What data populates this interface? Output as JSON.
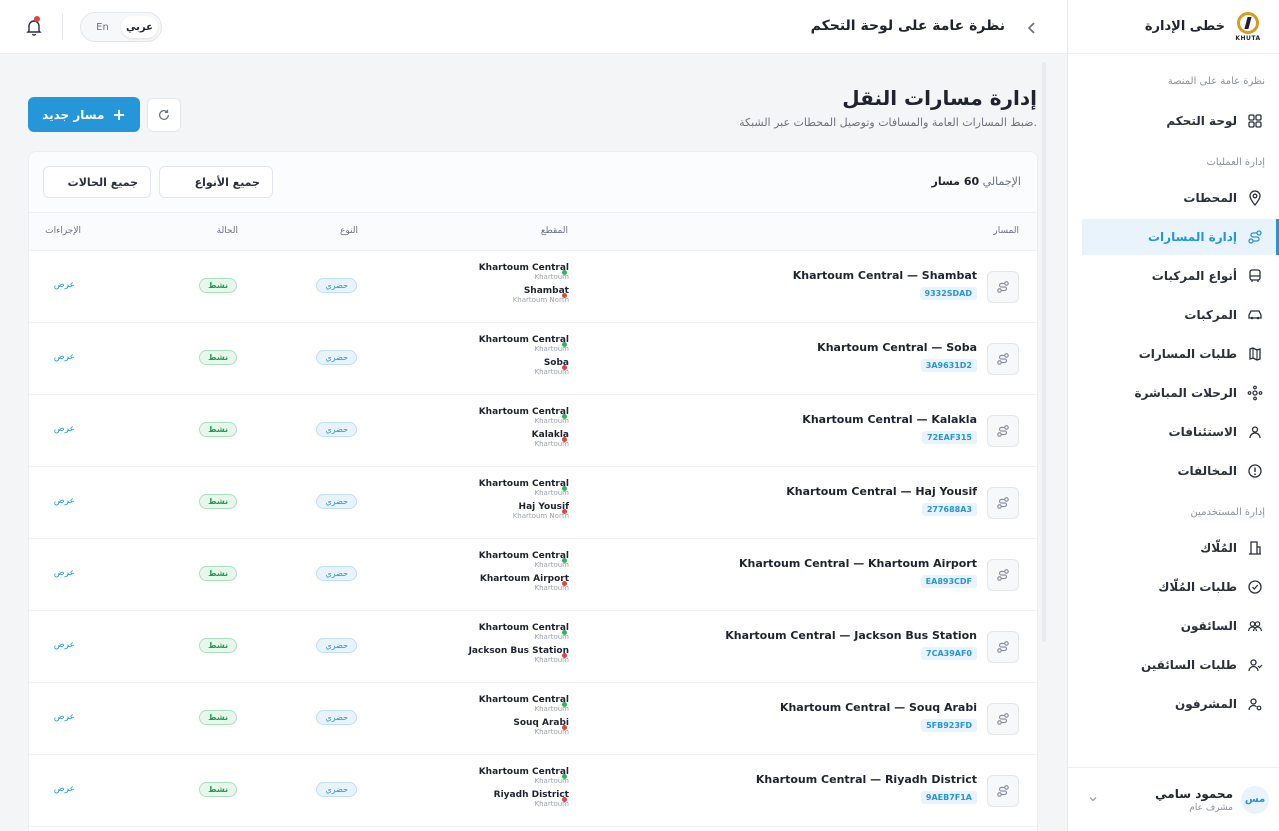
{
  "sidebar": {
    "brand": "خطى الإدارة",
    "logo_text": "KHUTA",
    "sections": {
      "platform": "نظرة عامة على المنصة",
      "operations": "إدارة العمليات",
      "users": "إدارة المستخدمين"
    },
    "items": {
      "dashboard": "لوحة التحكم",
      "stations": "المحطات",
      "routes": "إدارة المسارات",
      "vehicle_types": "أنواع المركبات",
      "vehicles": "المركبات",
      "route_requests": "طلبات المسارات",
      "live_trips": "الرحلات المباشرة",
      "appeals": "الاستئنافات",
      "violations": "المخالفات",
      "owners": "المُلّاك",
      "owner_requests": "طلبات المُلّاك",
      "drivers": "السائقون",
      "driver_requests": "طلبات السائقين",
      "supervisors": "المشرفون"
    },
    "user": {
      "name": "محمود سامي",
      "role": "مشرف عام",
      "initials": "مس"
    }
  },
  "topbar": {
    "title": "نظرة عامة على لوحة التحكم",
    "lang_ar": "عربي",
    "lang_en": "En"
  },
  "page": {
    "title": "إدارة مسارات النقل",
    "subtitle": "ضبط المسارات العامة والمسافات وتوصيل المحطات عبر الشبكة.",
    "new_button": "مسار جديد",
    "total_label": "الإجمالي",
    "total_value": "60 مسار",
    "filter_types": "جميع الأنواع",
    "filter_status": "جميع الحالات"
  },
  "table": {
    "headers": {
      "route": "المسار",
      "segment": "المقطع",
      "type": "النوع",
      "status": "الحالة",
      "actions": "الإجراءات"
    },
    "rows": [
      {
        "name": "Khartoum Central — Shambat",
        "code": "9332SDAD",
        "from": "Khartoum Central",
        "from_area": "Khartoum",
        "to": "Shambat",
        "to_area": "Khartoum North",
        "type": "حضري",
        "status": "نشط",
        "action": "عرض"
      },
      {
        "name": "Khartoum Central — Soba",
        "code": "3A9631D2",
        "from": "Khartoum Central",
        "from_area": "Khartoum",
        "to": "Soba",
        "to_area": "Khartoum",
        "type": "حضري",
        "status": "نشط",
        "action": "عرض"
      },
      {
        "name": "Khartoum Central — Kalakla",
        "code": "72EAF315",
        "from": "Khartoum Central",
        "from_area": "Khartoum",
        "to": "Kalakla",
        "to_area": "Khartoum",
        "type": "حضري",
        "status": "نشط",
        "action": "عرض"
      },
      {
        "name": "Khartoum Central — Haj Yousif",
        "code": "277688A3",
        "from": "Khartoum Central",
        "from_area": "Khartoum",
        "to": "Haj Yousif",
        "to_area": "Khartoum North",
        "type": "حضري",
        "status": "نشط",
        "action": "عرض"
      },
      {
        "name": "Khartoum Central — Khartoum Airport",
        "code": "EA893CDF",
        "from": "Khartoum Central",
        "from_area": "Khartoum",
        "to": "Khartoum Airport",
        "to_area": "Khartoum",
        "type": "حضري",
        "status": "نشط",
        "action": "عرض"
      },
      {
        "name": "Khartoum Central — Jackson Bus Station",
        "code": "7CA39AF0",
        "from": "Khartoum Central",
        "from_area": "Khartoum",
        "to": "Jackson Bus Station",
        "to_area": "Khartoum",
        "type": "حضري",
        "status": "نشط",
        "action": "عرض"
      },
      {
        "name": "Khartoum Central — Souq Arabi",
        "code": "5FB923FD",
        "from": "Khartoum Central",
        "from_area": "Khartoum",
        "to": "Souq Arabi",
        "to_area": "Khartoum",
        "type": "حضري",
        "status": "نشط",
        "action": "عرض"
      },
      {
        "name": "Khartoum Central — Riyadh District",
        "code": "9AEB7F1A",
        "from": "Khartoum Central",
        "from_area": "Khartoum",
        "to": "Riyadh District",
        "to_area": "Khartoum",
        "type": "حضري",
        "status": "نشط",
        "action": "عرض"
      }
    ]
  }
}
